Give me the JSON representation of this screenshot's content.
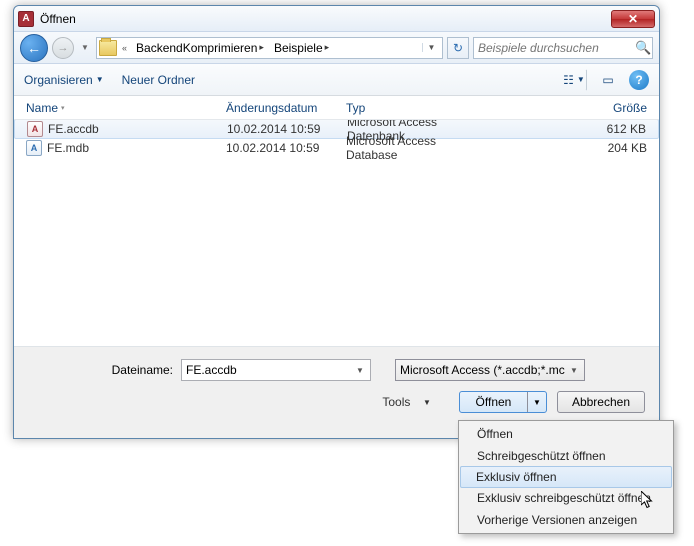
{
  "titlebar": {
    "title": "Öffnen"
  },
  "nav": {
    "path_prefix": "«",
    "segment1": "BackendKomprimieren",
    "segment2": "Beispiele"
  },
  "search": {
    "placeholder": "Beispiele durchsuchen"
  },
  "toolbar": {
    "organize": "Organisieren",
    "new_folder": "Neuer Ordner"
  },
  "columns": {
    "name": "Name",
    "modified": "Änderungsdatum",
    "type": "Typ",
    "size": "Größe"
  },
  "files": [
    {
      "name": "FE.accdb",
      "modified": "10.02.2014 10:59",
      "type": "Microsoft Access Datenbank",
      "size": "612 KB",
      "ic": "acc"
    },
    {
      "name": "FE.mdb",
      "modified": "10.02.2014 10:59",
      "type": "Microsoft Access Database",
      "size": "204 KB",
      "ic": "mdb"
    }
  ],
  "bottom": {
    "filename_label": "Dateiname:",
    "filename_value": "FE.accdb",
    "filter": "Microsoft Access (*.accdb;*.mc",
    "tools": "Tools",
    "open": "Öffnen",
    "cancel": "Abbrechen"
  },
  "dropdown": {
    "items": [
      "Öffnen",
      "Schreibgeschützt öffnen",
      "Exklusiv öffnen",
      "Exklusiv schreibgeschützt öffnen",
      "Vorherige Versionen anzeigen"
    ],
    "hover_index": 2
  }
}
